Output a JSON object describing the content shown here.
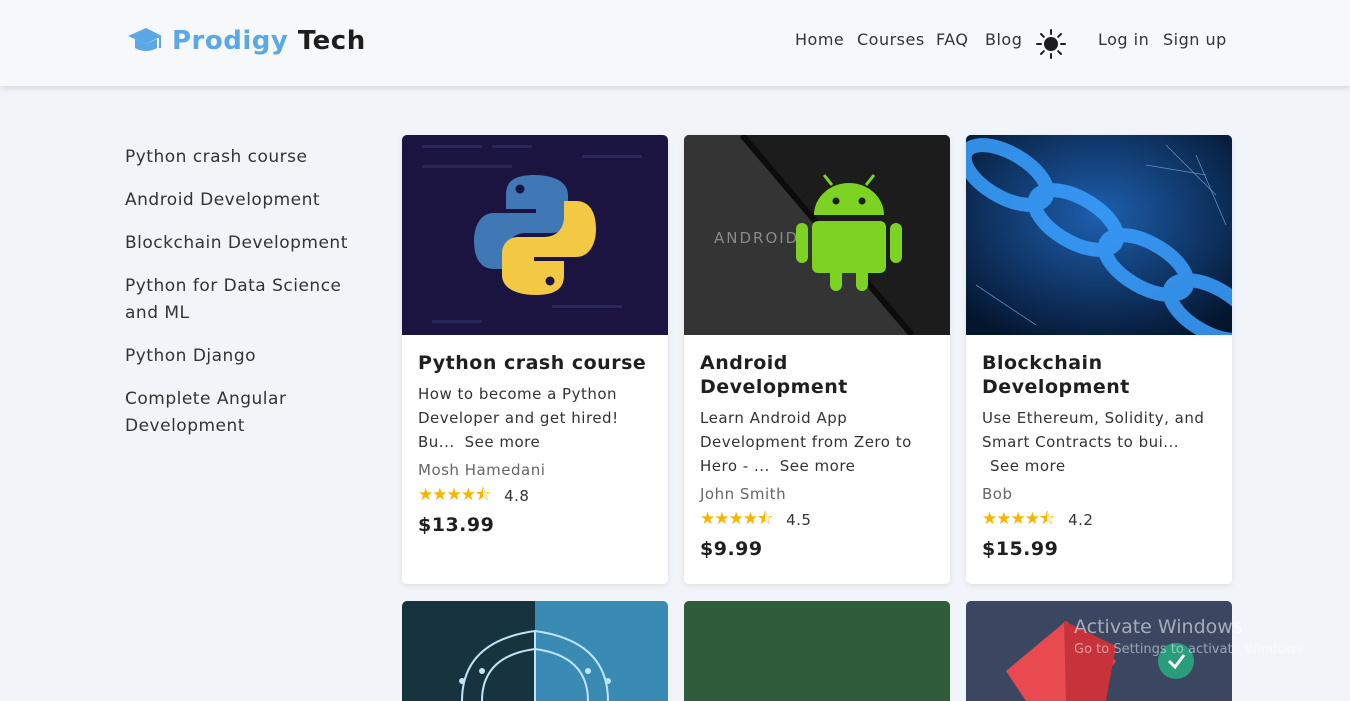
{
  "header": {
    "logo_part1": "Prodigy",
    "logo_part2": "Tech",
    "nav": [
      "Home",
      "Courses",
      "FAQ",
      "Blog"
    ],
    "theme_icon": "sun-icon",
    "login": "Log in",
    "signup": "Sign up"
  },
  "sidebar": {
    "items": [
      "Python crash course",
      "Android Development",
      "Blockchain Development",
      "Python for Data Science and ML",
      "Python Django",
      "Complete Angular Development"
    ]
  },
  "courses": [
    {
      "title": "Python crash course",
      "description": "How to become a Python Developer and get hired! Bu...",
      "see_more": "See more",
      "author": "Mosh Hamedani",
      "rating": "4.8",
      "stars": "★★★★⯪",
      "price": "$13.99"
    },
    {
      "title": "Android Development",
      "description": "Learn Android App Development from Zero to Hero - ...",
      "see_more": "See more",
      "author": "John Smith",
      "rating": "4.5",
      "stars": "★★★★⯪",
      "price": "$9.99"
    },
    {
      "title": "Blockchain Development",
      "description": "Use Ethereum, Solidity, and Smart Contracts to bui...",
      "see_more": "See more",
      "author": "Bob",
      "rating": "4.2",
      "stars": "★★★★⯪",
      "price": "$15.99"
    }
  ],
  "android_logo_text": "ANDROID",
  "watermark": {
    "title": "Activate Windows",
    "subtitle": "Go to Settings to activate Windows."
  },
  "colors": {
    "accent": "#5aa9e6",
    "star": "#f7b500",
    "background": "#f1f4f8"
  }
}
